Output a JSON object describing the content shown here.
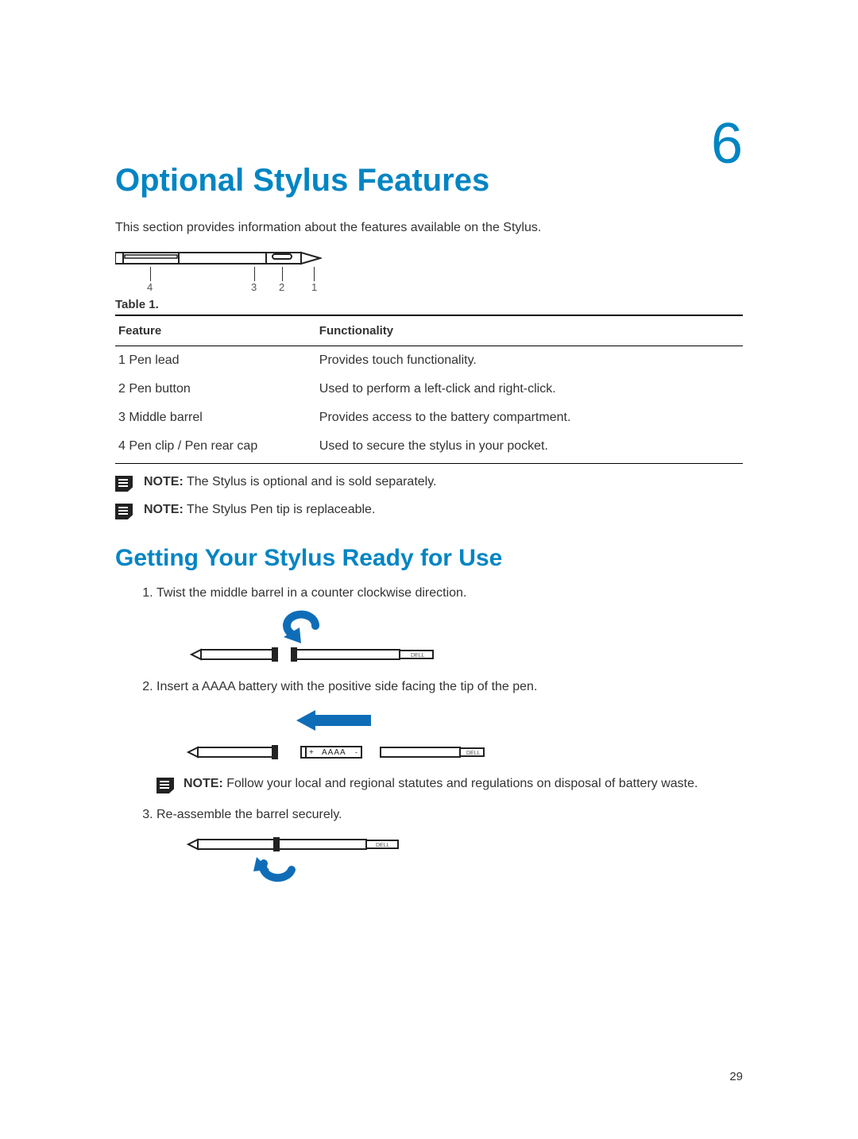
{
  "chapter_number": "6",
  "title": "Optional Stylus Features",
  "intro": "This section provides information about the features available on the Stylus.",
  "diagram_labels": {
    "l1": "1",
    "l2": "2",
    "l3": "3",
    "l4": "4"
  },
  "table": {
    "caption": "Table 1.",
    "headers": {
      "feature": "Feature",
      "functionality": "Functionality"
    },
    "rows": [
      {
        "feature": "1 Pen lead",
        "functionality": "Provides touch functionality."
      },
      {
        "feature": "2 Pen button",
        "functionality": "Used to perform a left-click and right-click."
      },
      {
        "feature": "3 Middle barrel",
        "functionality": "Provides access to the battery compartment."
      },
      {
        "feature": "4 Pen clip / Pen rear cap",
        "functionality": "Used to secure the stylus in your pocket."
      }
    ]
  },
  "notes": {
    "label": "NOTE:",
    "n1": " The Stylus is optional and is sold separately.",
    "n2": " The Stylus Pen tip is replaceable."
  },
  "section2": {
    "heading": "Getting Your Stylus Ready for Use",
    "steps": {
      "s1": "Twist the middle barrel in a counter clockwise direction.",
      "s2": "Insert a AAAA battery with the positive side facing the tip of the pen.",
      "s2_note": " Follow your local and regional statutes and regulations on disposal of battery waste.",
      "s3": "Re-assemble the barrel securely."
    }
  },
  "battery_label": {
    "plus": "+",
    "text": "AAAA",
    "minus": "-"
  },
  "brand_label": "DELL",
  "page_number": "29"
}
